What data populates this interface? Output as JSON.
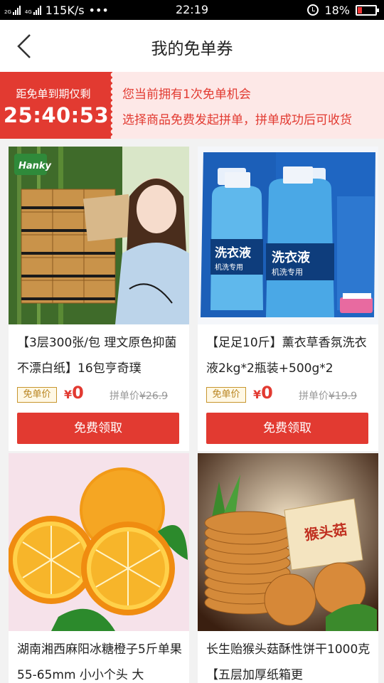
{
  "status_bar": {
    "signal1_label": "2G",
    "signal2_label": "4G",
    "net_speed": "115K/s",
    "more": "•••",
    "time": "22:19",
    "battery": "18%"
  },
  "header": {
    "title": "我的免单券"
  },
  "banner": {
    "countdown_label": "距免单到期仅剩",
    "countdown_time": "25:40:53",
    "line1": "您当前拥有1次免单机会",
    "line2": "选择商品免费发起拼单，拼单成功后可收货"
  },
  "products": [
    {
      "title": "【3层300张/包 理文原色抑菌不漂白纸】16包亨奇璞",
      "free_tag": "免单价",
      "price_now": "0",
      "currency": "¥",
      "group_label": "拼单价",
      "group_price": "¥26.9",
      "button": "免费领取"
    },
    {
      "title": "【足足10斤】薰衣草香氛洗衣液2kg*2瓶装+500g*2",
      "free_tag": "免单价",
      "price_now": "0",
      "currency": "¥",
      "group_label": "拼单价",
      "group_price": "¥19.9",
      "button": "免费领取"
    },
    {
      "title": "湖南湘西麻阳冰糖橙子5斤单果55-65mm 小小个头 大"
    },
    {
      "title": "长生贻猴头菇酥性饼干1000克【五层加厚纸箱更"
    }
  ],
  "image_text": {
    "hanky_logo": "Hanky",
    "detergent_label": "洗衣液",
    "detergent_sub": "机洗专用",
    "biscuit_label": "猴头菇"
  },
  "colors": {
    "accent": "#e23a31",
    "banner_bg": "#fde8e7",
    "tag_gold": "#c8962e"
  }
}
